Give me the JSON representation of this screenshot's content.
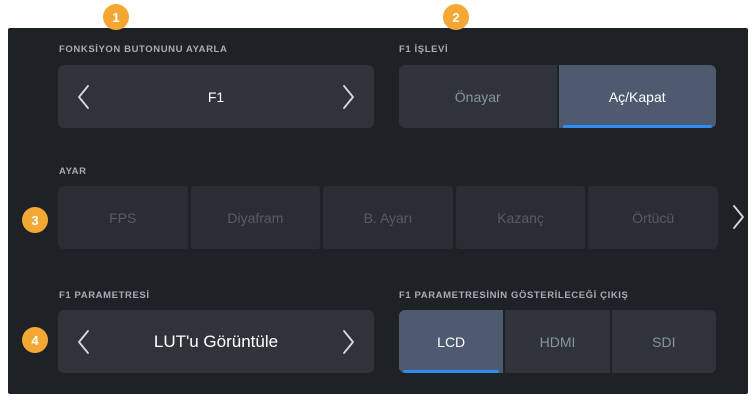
{
  "callouts": [
    "1",
    "2",
    "3",
    "4"
  ],
  "function_button": {
    "label": "FONKSİYON BUTONUNU AYARLA",
    "value": "F1"
  },
  "f1_function": {
    "label": "F1 İŞLEVİ",
    "options": [
      "Önayar",
      "Aç/Kapat"
    ],
    "selected": "Aç/Kapat"
  },
  "setting": {
    "label": "AYAR",
    "options": [
      "FPS",
      "Diyafram",
      "B. Ayarı",
      "Kazanç",
      "Örtücü"
    ]
  },
  "f1_parameter": {
    "label": "F1 PARAMETRESİ",
    "value": "LUT'u Görüntüle"
  },
  "f1_output": {
    "label": "F1 PARAMETRESİNİN GÖSTERİLECEĞİ ÇIKIŞ",
    "options": [
      "LCD",
      "HDMI",
      "SDI"
    ],
    "selected": "LCD"
  },
  "colors": {
    "accent": "#2f8ef3",
    "badge": "#f3a833",
    "panel_bg": "#1e2126"
  }
}
